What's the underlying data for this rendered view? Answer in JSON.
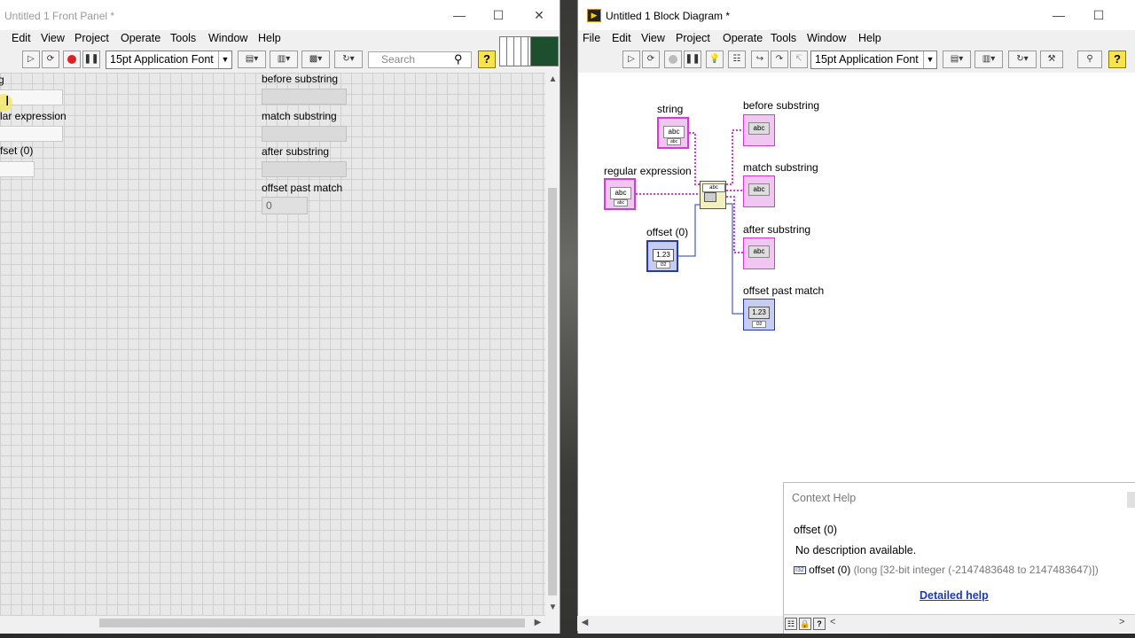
{
  "front_panel": {
    "title": "Untitled 1 Front Panel *",
    "menu": [
      "Edit",
      "View",
      "Project",
      "Operate",
      "Tools",
      "Window",
      "Help"
    ],
    "font_select": "15pt Application Font",
    "search_placeholder": "Search",
    "controls": {
      "string_label": "g",
      "regex_label": "lar expression",
      "offset_label": "fset (0)",
      "before_label": "before substring",
      "match_label": "match substring",
      "after_label": "after substring",
      "offset_past_label": "offset past match",
      "offset_past_value": "0"
    }
  },
  "block_diagram": {
    "title": "Untitled 1 Block Diagram *",
    "menu": [
      "File",
      "Edit",
      "View",
      "Project",
      "Operate",
      "Tools",
      "Window",
      "Help"
    ],
    "font_select": "15pt Application Font",
    "terminals": {
      "string": "string",
      "regex": "regular expression",
      "offset": "offset (0)",
      "before": "before substring",
      "match": "match substring",
      "after": "after substring",
      "offset_past": "offset past match"
    },
    "str_glyph": "abc",
    "num_glyph": "1.23",
    "str_tag": "abc",
    "num_tag": "I32"
  },
  "context_help": {
    "title": "Context Help",
    "name": "offset (0)",
    "description": "No description available.",
    "terminal_name": "offset (0)",
    "terminal_type": "(long [32-bit integer (-2147483648 to 2147483647)])",
    "type_tag": "I32",
    "link": "Detailed help"
  }
}
